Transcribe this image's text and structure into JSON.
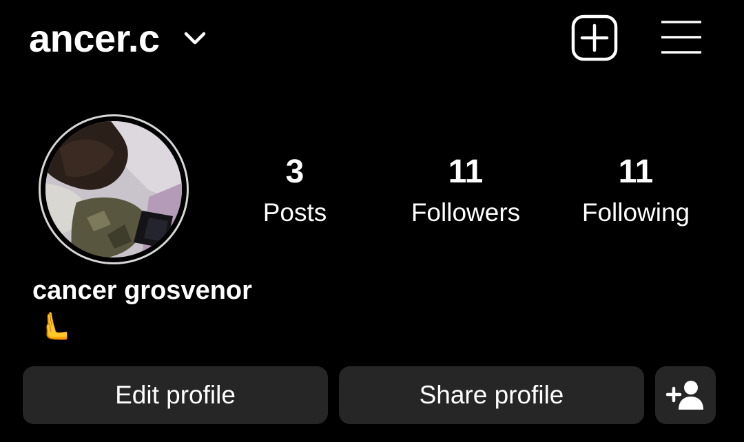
{
  "header": {
    "username": "ancer.c",
    "dropdown_icon": "chevron-down-icon",
    "create_icon": "plus-square-icon",
    "menu_icon": "hamburger-menu-icon"
  },
  "profile": {
    "avatar_icon": "profile-photo",
    "stats": [
      {
        "count": "3",
        "label": "Posts"
      },
      {
        "count": "11",
        "label": "Followers"
      },
      {
        "count": "11",
        "label": "Following"
      }
    ],
    "full_name": "cancer grosvenor",
    "bio": "🫷"
  },
  "actions": {
    "edit_label": "Edit profile",
    "share_label": "Share profile",
    "discover_icon": "add-person-icon"
  },
  "colors": {
    "background": "#000000",
    "button_bg": "#262626",
    "text": "#ffffff",
    "avatar_ring": "#d7d7d7"
  }
}
